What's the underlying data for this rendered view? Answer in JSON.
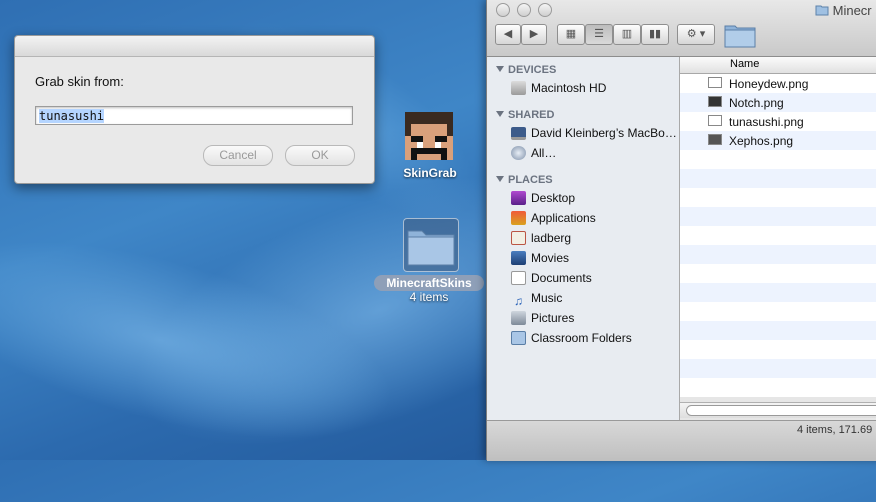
{
  "dialog": {
    "prompt": "Grab skin from:",
    "value": "tunasushi",
    "cancel_label": "Cancel",
    "ok_label": "OK"
  },
  "desktop": {
    "app_icon_label": "SkinGrab",
    "folder_label": "MinecraftSkins",
    "folder_count": "4 items"
  },
  "finder": {
    "title": "Minecr",
    "sidebar": {
      "devices_header": "DEVICES",
      "devices": [
        {
          "label": "Macintosh HD",
          "icon": "hard-drive-icon"
        }
      ],
      "shared_header": "SHARED",
      "shared": [
        {
          "label": "David Kleinberg’s MacBo…",
          "icon": "laptop-icon"
        },
        {
          "label": "All…",
          "icon": "network-globe-icon"
        }
      ],
      "places_header": "PLACES",
      "places": [
        {
          "label": "Desktop",
          "icon": "desktop-icon"
        },
        {
          "label": "Applications",
          "icon": "applications-icon"
        },
        {
          "label": "ladberg",
          "icon": "home-icon"
        },
        {
          "label": "Movies",
          "icon": "movies-icon"
        },
        {
          "label": "Documents",
          "icon": "documents-icon"
        },
        {
          "label": "Music",
          "icon": "music-icon"
        },
        {
          "label": "Pictures",
          "icon": "pictures-icon"
        },
        {
          "label": "Classroom Folders",
          "icon": "folder-icon"
        }
      ]
    },
    "column_name": "Name",
    "files": [
      "Honeydew.png",
      "Notch.png",
      "tunasushi.png",
      "Xephos.png"
    ],
    "status": "4 items, 171.69"
  },
  "colors": {
    "desktop_bg": "#2f6fb3",
    "selection": "#b5d5ff",
    "stripe": "#edf3fe"
  }
}
